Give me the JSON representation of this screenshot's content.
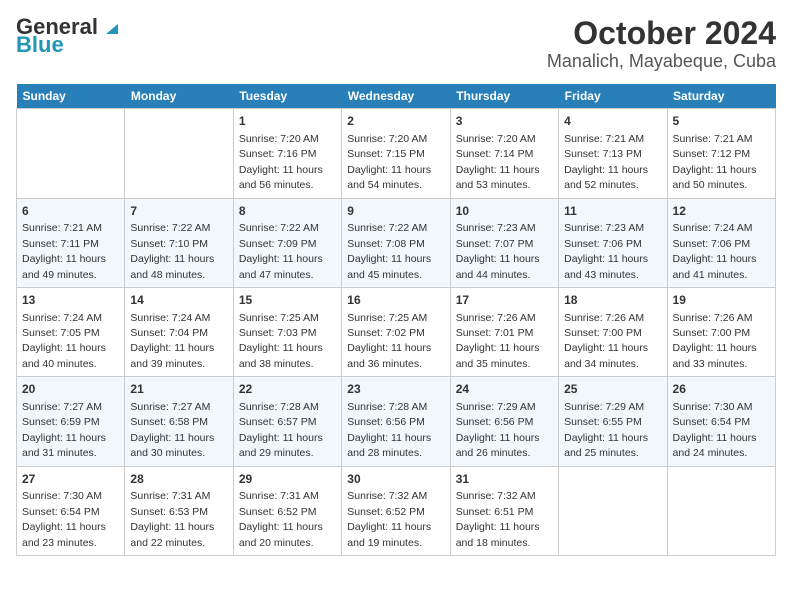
{
  "header": {
    "logo_line1": "General",
    "logo_line2": "Blue",
    "title": "October 2024",
    "subtitle": "Manalich, Mayabeque, Cuba"
  },
  "calendar": {
    "days_of_week": [
      "Sunday",
      "Monday",
      "Tuesday",
      "Wednesday",
      "Thursday",
      "Friday",
      "Saturday"
    ],
    "weeks": [
      [
        {
          "day": "",
          "content": ""
        },
        {
          "day": "",
          "content": ""
        },
        {
          "day": "1",
          "content": "Sunrise: 7:20 AM\nSunset: 7:16 PM\nDaylight: 11 hours and 56 minutes."
        },
        {
          "day": "2",
          "content": "Sunrise: 7:20 AM\nSunset: 7:15 PM\nDaylight: 11 hours and 54 minutes."
        },
        {
          "day": "3",
          "content": "Sunrise: 7:20 AM\nSunset: 7:14 PM\nDaylight: 11 hours and 53 minutes."
        },
        {
          "day": "4",
          "content": "Sunrise: 7:21 AM\nSunset: 7:13 PM\nDaylight: 11 hours and 52 minutes."
        },
        {
          "day": "5",
          "content": "Sunrise: 7:21 AM\nSunset: 7:12 PM\nDaylight: 11 hours and 50 minutes."
        }
      ],
      [
        {
          "day": "6",
          "content": "Sunrise: 7:21 AM\nSunset: 7:11 PM\nDaylight: 11 hours and 49 minutes."
        },
        {
          "day": "7",
          "content": "Sunrise: 7:22 AM\nSunset: 7:10 PM\nDaylight: 11 hours and 48 minutes."
        },
        {
          "day": "8",
          "content": "Sunrise: 7:22 AM\nSunset: 7:09 PM\nDaylight: 11 hours and 47 minutes."
        },
        {
          "day": "9",
          "content": "Sunrise: 7:22 AM\nSunset: 7:08 PM\nDaylight: 11 hours and 45 minutes."
        },
        {
          "day": "10",
          "content": "Sunrise: 7:23 AM\nSunset: 7:07 PM\nDaylight: 11 hours and 44 minutes."
        },
        {
          "day": "11",
          "content": "Sunrise: 7:23 AM\nSunset: 7:06 PM\nDaylight: 11 hours and 43 minutes."
        },
        {
          "day": "12",
          "content": "Sunrise: 7:24 AM\nSunset: 7:06 PM\nDaylight: 11 hours and 41 minutes."
        }
      ],
      [
        {
          "day": "13",
          "content": "Sunrise: 7:24 AM\nSunset: 7:05 PM\nDaylight: 11 hours and 40 minutes."
        },
        {
          "day": "14",
          "content": "Sunrise: 7:24 AM\nSunset: 7:04 PM\nDaylight: 11 hours and 39 minutes."
        },
        {
          "day": "15",
          "content": "Sunrise: 7:25 AM\nSunset: 7:03 PM\nDaylight: 11 hours and 38 minutes."
        },
        {
          "day": "16",
          "content": "Sunrise: 7:25 AM\nSunset: 7:02 PM\nDaylight: 11 hours and 36 minutes."
        },
        {
          "day": "17",
          "content": "Sunrise: 7:26 AM\nSunset: 7:01 PM\nDaylight: 11 hours and 35 minutes."
        },
        {
          "day": "18",
          "content": "Sunrise: 7:26 AM\nSunset: 7:00 PM\nDaylight: 11 hours and 34 minutes."
        },
        {
          "day": "19",
          "content": "Sunrise: 7:26 AM\nSunset: 7:00 PM\nDaylight: 11 hours and 33 minutes."
        }
      ],
      [
        {
          "day": "20",
          "content": "Sunrise: 7:27 AM\nSunset: 6:59 PM\nDaylight: 11 hours and 31 minutes."
        },
        {
          "day": "21",
          "content": "Sunrise: 7:27 AM\nSunset: 6:58 PM\nDaylight: 11 hours and 30 minutes."
        },
        {
          "day": "22",
          "content": "Sunrise: 7:28 AM\nSunset: 6:57 PM\nDaylight: 11 hours and 29 minutes."
        },
        {
          "day": "23",
          "content": "Sunrise: 7:28 AM\nSunset: 6:56 PM\nDaylight: 11 hours and 28 minutes."
        },
        {
          "day": "24",
          "content": "Sunrise: 7:29 AM\nSunset: 6:56 PM\nDaylight: 11 hours and 26 minutes."
        },
        {
          "day": "25",
          "content": "Sunrise: 7:29 AM\nSunset: 6:55 PM\nDaylight: 11 hours and 25 minutes."
        },
        {
          "day": "26",
          "content": "Sunrise: 7:30 AM\nSunset: 6:54 PM\nDaylight: 11 hours and 24 minutes."
        }
      ],
      [
        {
          "day": "27",
          "content": "Sunrise: 7:30 AM\nSunset: 6:54 PM\nDaylight: 11 hours and 23 minutes."
        },
        {
          "day": "28",
          "content": "Sunrise: 7:31 AM\nSunset: 6:53 PM\nDaylight: 11 hours and 22 minutes."
        },
        {
          "day": "29",
          "content": "Sunrise: 7:31 AM\nSunset: 6:52 PM\nDaylight: 11 hours and 20 minutes."
        },
        {
          "day": "30",
          "content": "Sunrise: 7:32 AM\nSunset: 6:52 PM\nDaylight: 11 hours and 19 minutes."
        },
        {
          "day": "31",
          "content": "Sunrise: 7:32 AM\nSunset: 6:51 PM\nDaylight: 11 hours and 18 minutes."
        },
        {
          "day": "",
          "content": ""
        },
        {
          "day": "",
          "content": ""
        }
      ]
    ]
  }
}
